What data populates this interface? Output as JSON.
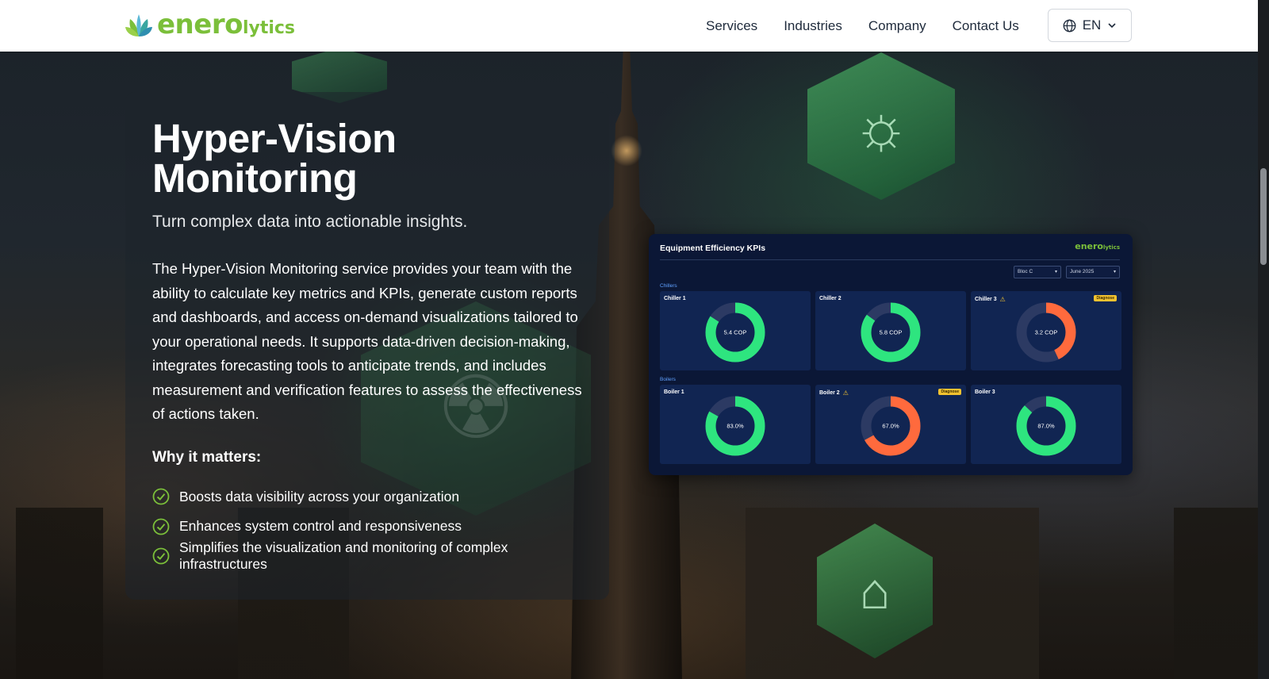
{
  "header": {
    "logo": {
      "brand_main": "enero",
      "brand_suffix": "lytics"
    },
    "nav": [
      "Services",
      "Industries",
      "Company",
      "Contact Us"
    ],
    "language": {
      "label": "EN"
    }
  },
  "hero": {
    "title_line1": "Hyper-Vision",
    "title_line2": "Monitoring",
    "subtitle": "Turn complex data into actionable insights.",
    "description": "The Hyper-Vision Monitoring service provides your team with the ability to calculate key metrics and KPIs, generate custom reports and dashboards, and access on-demand visualizations tailored to your operational needs. It supports data-driven decision-making, integrates forecasting tools to anticipate trends, and includes measurement and verification features to assess the effectiveness of actions taken.",
    "why_heading": "Why it matters:",
    "bullets": [
      "Boosts data visibility across your organization",
      "Enhances system control and responsiveness",
      "Simplifies the visualization and monitoring of complex infrastructures"
    ]
  },
  "dashboard": {
    "title": "Equipment Efficiency KPIs",
    "logo_main": "enero",
    "logo_suffix": "lytics",
    "filters": {
      "building": "Bloc C",
      "month": "June 2025"
    },
    "sections": {
      "chillers": "Chillers",
      "boilers": "Boilers"
    },
    "diagnose_label": "Diagnose",
    "colors": {
      "good": "#2ee57f",
      "bad": "#ff6a3d",
      "track": "#2c3a63",
      "warning": "#f2c230"
    }
  },
  "chart_data": {
    "type": "donut-grid",
    "items": [
      {
        "name": "Chiller 1",
        "label": "5.4 COP",
        "fill": 0.84,
        "status": "good",
        "warning": false
      },
      {
        "name": "Chiller 2",
        "label": "5.8 COP",
        "fill": 0.85,
        "status": "good",
        "warning": false
      },
      {
        "name": "Chiller 3",
        "label": "3.2 COP",
        "fill": 0.43,
        "status": "bad",
        "warning": true
      },
      {
        "name": "Boiler 1",
        "label": "83.0%",
        "fill": 0.83,
        "status": "good",
        "warning": false
      },
      {
        "name": "Boiler 2",
        "label": "67.0%",
        "fill": 0.67,
        "status": "bad",
        "warning": true
      },
      {
        "name": "Boiler 3",
        "label": "87.0%",
        "fill": 0.87,
        "status": "good",
        "warning": false
      }
    ]
  }
}
